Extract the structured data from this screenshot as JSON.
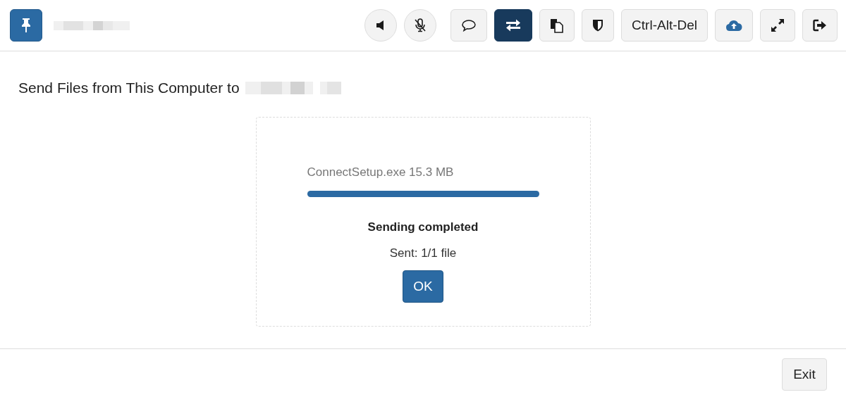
{
  "toolbar": {
    "pin": {
      "on": true
    },
    "buttons": [
      {
        "kind": "round",
        "selected": false
      },
      {
        "kind": "round",
        "selected": false
      },
      {
        "kind": "square",
        "selected": false
      },
      {
        "kind": "square",
        "selected": true
      },
      {
        "kind": "square",
        "selected": false
      },
      {
        "kind": "square",
        "selected": false
      },
      {
        "kind": "square",
        "label": "Ctrl-Alt-Del",
        "selected": false
      },
      {
        "kind": "square",
        "selected": false
      },
      {
        "kind": "square",
        "selected": false
      },
      {
        "kind": "square",
        "selected": false
      }
    ]
  },
  "heading": "Send Files from This Computer to",
  "transfer": {
    "file": "ConnectSetup.exe 15.3 MB",
    "level": 1,
    "status": "Sending completed",
    "count": "Sent: 1/1 file",
    "button": "OK"
  },
  "footer": {
    "button": "Exit"
  }
}
